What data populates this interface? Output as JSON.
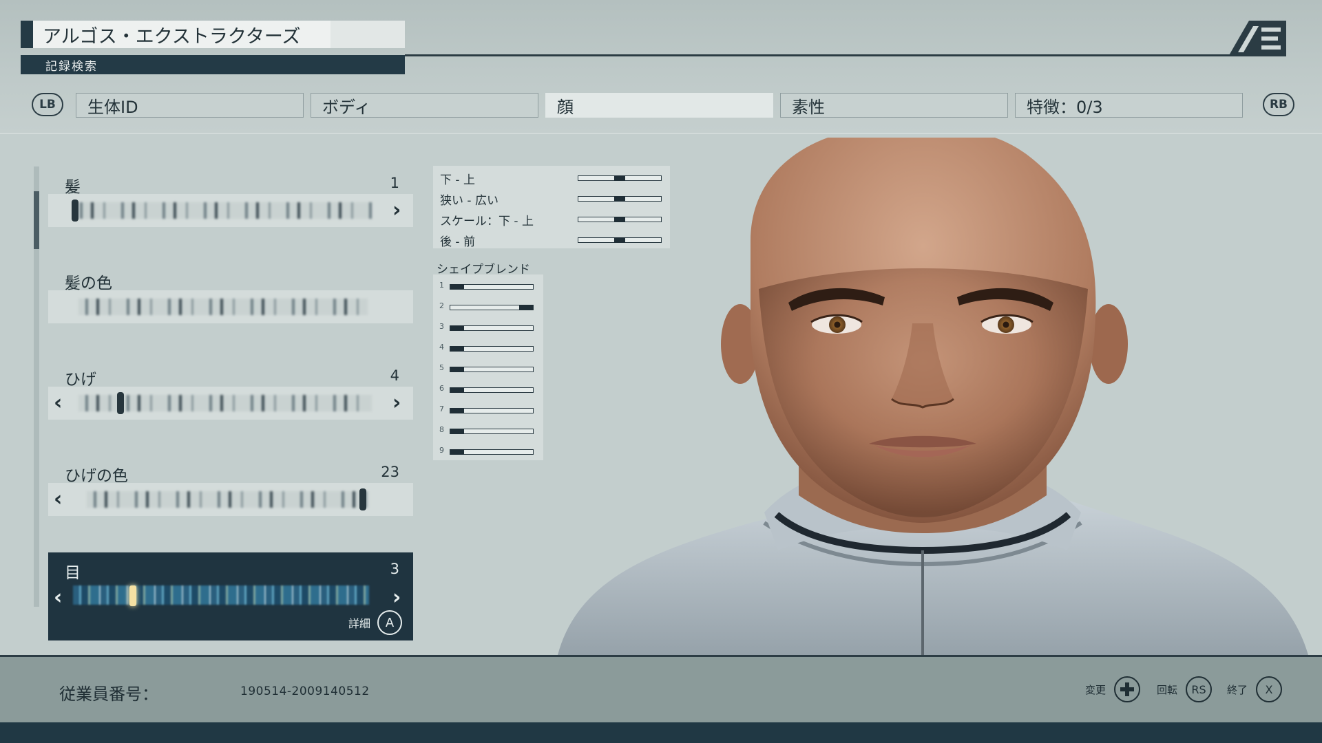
{
  "header": {
    "title": "アルゴス・エクストラクターズ",
    "subtitle": "記録検索",
    "logo_text": "AE"
  },
  "tabs": {
    "lb": "LB",
    "rb": "RB",
    "items": [
      {
        "label": "生体ID",
        "active": false
      },
      {
        "label": "ボディ",
        "active": false
      },
      {
        "label": "顔",
        "active": true
      },
      {
        "label": "素性",
        "active": false
      },
      {
        "label": "特徴：0/3",
        "active": false
      }
    ]
  },
  "options": [
    {
      "label": "髪",
      "value": "1"
    },
    {
      "label": "髪の色",
      "value": ""
    },
    {
      "label": "ひげ",
      "value": "4"
    },
    {
      "label": "ひげの色",
      "value": "23"
    },
    {
      "label": "目",
      "value": "3",
      "detail": "詳細",
      "detail_button": "A"
    }
  ],
  "sliders": [
    {
      "label": "下 - 上",
      "value": 0.5
    },
    {
      "label": "狭い - 広い",
      "value": 0.5
    },
    {
      "label": "スケール：下 - 上",
      "value": 0.5
    },
    {
      "label": "後 - 前",
      "value": 0.5
    }
  ],
  "shape_blend": {
    "title": "シェイプブレンド",
    "items": [
      {
        "n": "1",
        "value": 0.0
      },
      {
        "n": "2",
        "value": 1.0
      },
      {
        "n": "3",
        "value": 0.0
      },
      {
        "n": "4",
        "value": 0.0
      },
      {
        "n": "5",
        "value": 0.0
      },
      {
        "n": "6",
        "value": 0.0
      },
      {
        "n": "7",
        "value": 0.0
      },
      {
        "n": "8",
        "value": 0.0
      },
      {
        "n": "9",
        "value": 0.0
      }
    ]
  },
  "footer": {
    "employee_label": "従業員番号：",
    "employee_value": "190514-2009140512",
    "hints": [
      {
        "label": "変更",
        "button": "dpad"
      },
      {
        "label": "回転",
        "button": "RS"
      },
      {
        "label": "終了",
        "button": "X"
      }
    ]
  },
  "colors": {
    "panel_dark": "#1f3440",
    "accent_eye": "#f5e1a3",
    "bg": "#c3cecd"
  }
}
